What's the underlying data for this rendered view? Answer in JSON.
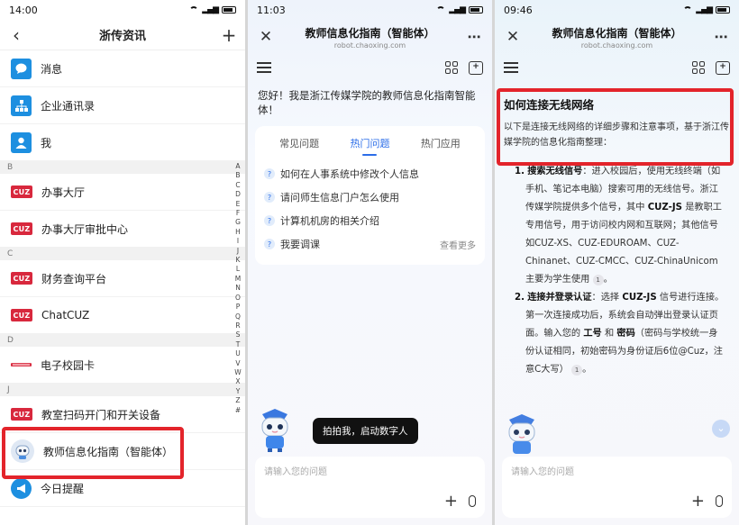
{
  "panel1": {
    "status": {
      "time": "14:00"
    },
    "title": "浙传资讯",
    "items": [
      {
        "label": "消息",
        "icon": "chat-bubble-icon"
      },
      {
        "label": "企业通讯录",
        "icon": "org-chart-icon"
      },
      {
        "label": "我",
        "icon": "person-icon"
      }
    ],
    "sections": [
      {
        "letter": "B",
        "items": [
          {
            "label": "办事大厅"
          },
          {
            "label": "办事大厅审批中心"
          }
        ]
      },
      {
        "letter": "C",
        "items": [
          {
            "label": "财务查询平台"
          },
          {
            "label": "ChatCUZ"
          }
        ]
      },
      {
        "letter": "D",
        "items": [
          {
            "label": "电子校园卡"
          }
        ]
      },
      {
        "letter": "J",
        "items": [
          {
            "label": "教室扫码开门和开关设备"
          },
          {
            "label": "教师信息化指南（智能体）"
          },
          {
            "label": "今日提醒"
          }
        ]
      }
    ],
    "cuz_badge": "CUZ",
    "index_letters": [
      "A",
      "B",
      "C",
      "D",
      "E",
      "F",
      "G",
      "H",
      "I",
      "J",
      "K",
      "L",
      "M",
      "N",
      "O",
      "P",
      "Q",
      "R",
      "S",
      "T",
      "U",
      "V",
      "W",
      "X",
      "Y",
      "Z",
      "#"
    ],
    "highlight_color": "#e3242b"
  },
  "panel2": {
    "status": {
      "time": "11:03"
    },
    "title": "教师信息化指南（智能体）",
    "url": "robot.chaoxing.com",
    "greeting": "您好！我是浙江传媒学院的教师信息化指南智能体！",
    "tabs": [
      "常见问题",
      "热门问题",
      "热门应用"
    ],
    "active_tab": 1,
    "questions": [
      "如何在人事系统中修改个人信息",
      "请问师生信息门户怎么使用",
      "计算机机房的相关介绍",
      "我要调课"
    ],
    "more": "查看更多",
    "bubble": "拍拍我，启动数字人",
    "input_placeholder": "请输入您的问题"
  },
  "panel3": {
    "status": {
      "time": "09:46"
    },
    "title": "教师信息化指南（智能体）",
    "url": "robot.chaoxing.com",
    "answer_title": "如何连接无线网络",
    "answer_intro": "以下是连接无线网络的详细步骤和注意事项，基于浙江传媒学院的信息化指南整理：",
    "steps": [
      {
        "num": "1.",
        "heading": "搜索无线信号",
        "text_a": "：进入校园后，使用无线终端（如手机、笔记本电脑）搜索可用的无线信号。浙江传媒学院提供多个信号，其中 ",
        "bold_a": "CUZ-JS",
        "text_b": " 是教职工专用信号，用于访问校内网和互联网；其他信号如CUZ-XS、CUZ-EDUROAM、CUZ-Chinanet、CUZ-CMCC、CUZ-ChinaUnicom 主要为学生使用",
        "cite": "1",
        "tail": "。"
      },
      {
        "num": "2.",
        "heading": "连接并登录认证",
        "text_a": "：选择 ",
        "bold_a": "CUZ-JS",
        "text_b": " 信号进行连接。第一次连接成功后，系统会自动弹出登录认证页面。输入您的 ",
        "bold_b": "工号",
        "text_c": " 和 ",
        "bold_c": "密码",
        "text_d": "（密码与学校统一身份认证相同，初始密码为身份证后6位@Cuz，注意C大写）",
        "cite": "1",
        "tail": "。"
      }
    ],
    "input_placeholder": "请输入您的问题"
  }
}
